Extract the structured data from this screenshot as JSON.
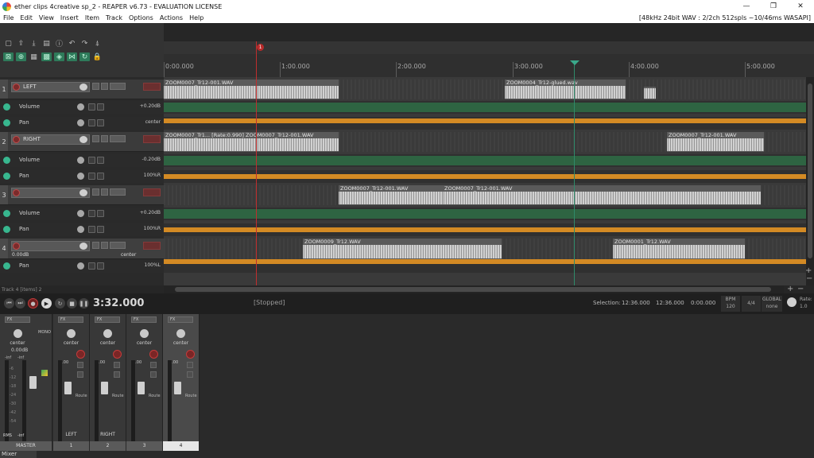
{
  "window": {
    "title": "ether clips 4creative sp_2 - REAPER v6.73 - EVALUATION LICENSE",
    "minimize": "—",
    "restore": "❐",
    "close": "✕"
  },
  "menu": {
    "items": [
      "File",
      "Edit",
      "View",
      "Insert",
      "Item",
      "Track",
      "Options",
      "Actions",
      "Help"
    ],
    "status": "[48kHz 24bit WAV : 2/2ch 512spls ~10/46ms WASAPI]"
  },
  "ruler": {
    "marker": "1",
    "labels": [
      "0:00.000",
      "1:00.000",
      "2:00.000",
      "3:00.000",
      "4:00.000",
      "5:00.000"
    ]
  },
  "tracks": [
    {
      "num": "1",
      "name": "LEFT",
      "vol_val": "+0.20dB",
      "pan_val": "center"
    },
    {
      "num": "2",
      "name": "RIGHT",
      "vol_val": "-0.20dB",
      "pan_val": "100%R"
    },
    {
      "num": "3",
      "name": "",
      "vol_val": "+0.20dB",
      "pan_val": "100%R"
    },
    {
      "num": "4",
      "name": "",
      "vol_readout": "0.00dB",
      "pan_readout": "center",
      "pan_val": "100%L"
    }
  ],
  "envelopes": {
    "volume": "Volume",
    "pan": "Pan"
  },
  "items": [
    {
      "label": "ZOOM0007_Tr12-001.WAV"
    },
    {
      "label": "ZOOM0004_Tr12-glued.wav"
    },
    {
      "label": "ZOOM0007_Tr1... [Rate:0.990] ZOOM0007_Tr12-001.WAV"
    },
    {
      "label": "ZOOM0007_Tr12-001.WAV"
    },
    {
      "label": "ZOOM0007_Tr12-001.WAV"
    },
    {
      "label": "ZOOM0007_Tr12-001.WAV"
    },
    {
      "label": "ZOOM0009_Tr12.WAV"
    },
    {
      "label": "ZOOM0001_Tr12.WAV"
    }
  ],
  "status_line": "Track 4 [items] 2",
  "transport": {
    "time": "3:32.000",
    "state": "[Stopped]",
    "selection_label": "Selection:",
    "sel_start": "12:36.000",
    "sel_end": "12:36.000",
    "sel_len": "0:00.000",
    "bpm_label": "BPM",
    "bpm": "120",
    "timesig": "4/4",
    "rate_label": "Rate:",
    "rate": "1.0",
    "global_label": "GLOBAL",
    "global_val": "none"
  },
  "mixer": {
    "master_name": "MASTER",
    "master_pan": "center",
    "master_vol": "0.00dB",
    "mono": "MONO",
    "rms": "RMS",
    "rms_val": "-inf",
    "inf_l": "-inf",
    "inf_r": "-inf",
    "strips": [
      {
        "pan": "center",
        "name": "LEFT",
        "foot": "1"
      },
      {
        "pan": "center",
        "name": "RIGHT",
        "foot": "2"
      },
      {
        "pan": "center",
        "name": "",
        "foot": "3"
      },
      {
        "pan": "center",
        "name": "",
        "foot": "4"
      }
    ],
    "fx": "FX",
    "route": "Route",
    "val": "0.00",
    "scale": [
      "-6",
      "-12",
      "-18",
      "-24",
      "-30",
      "-42",
      "-54"
    ],
    "tab": "Mixer"
  }
}
